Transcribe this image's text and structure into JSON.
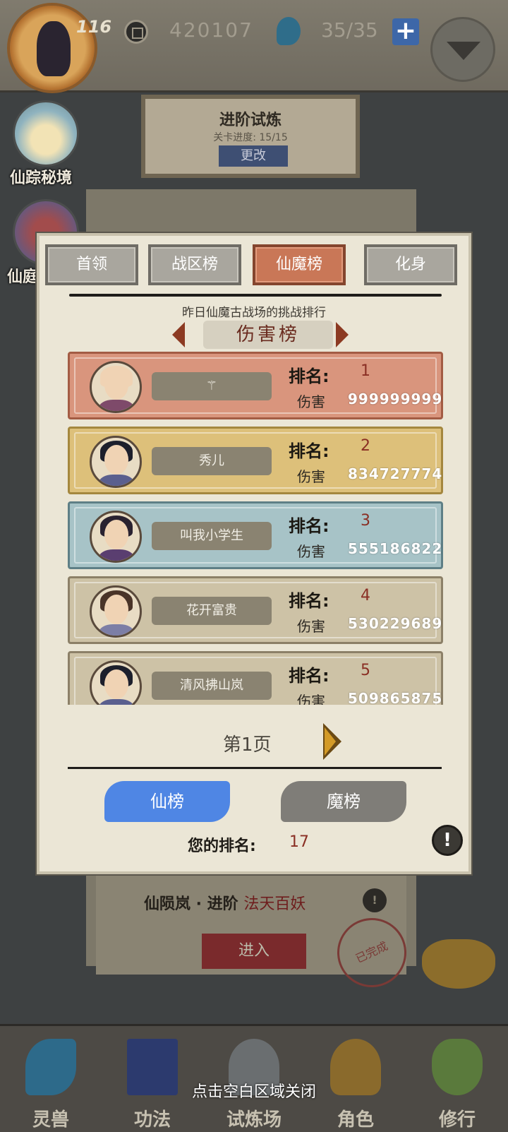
{
  "header": {
    "level": "116",
    "coins": "420107",
    "spirit": "35/35",
    "plus_label": "+"
  },
  "side_buttons": [
    {
      "label": "仙踪秘境"
    },
    {
      "label": "仙庭"
    }
  ],
  "trial_card": {
    "title": "进阶试炼",
    "progress": "关卡进度:  15/15",
    "change_label": "更改"
  },
  "background_stage": {
    "name": "仙陨岚 · 进阶",
    "boss": "法天百妖",
    "enter_label": "进入",
    "stamp": "已完成"
  },
  "modal": {
    "tabs": [
      {
        "label": "首领",
        "active": false
      },
      {
        "label": "战区榜",
        "active": false
      },
      {
        "label": "仙魔榜",
        "active": true
      },
      {
        "label": "化身",
        "active": false
      }
    ],
    "subtitle": "昨日仙魔古战场的挑战排行",
    "board_title": "伤害榜",
    "rank_label": "排名:",
    "damage_label": "伤害",
    "rows": [
      {
        "name": "⚚",
        "rank": "1",
        "damage": "999999999",
        "color": "#d9957d",
        "border": "#a35c44",
        "hair": "#f0d3b4",
        "body": "#7e4a6a"
      },
      {
        "name": "秀儿",
        "rank": "2",
        "damage": "834727774",
        "color": "#ddc07a",
        "border": "#a4873e",
        "hair": "#1d1f2c",
        "body": "#5a5f8e"
      },
      {
        "name": "叫我小学生",
        "rank": "3",
        "damage": "555186822",
        "color": "#a7c3c7",
        "border": "#5e7f86",
        "hair": "#2a2230",
        "body": "#5a3e70"
      },
      {
        "name": "花开富贵",
        "rank": "4",
        "damage": "530229689",
        "color": "#cdc2a6",
        "border": "#8c8068",
        "hair": "#4a3428",
        "body": "#7c7ea6"
      },
      {
        "name": "清风拂山岚",
        "rank": "5",
        "damage": "509865875",
        "color": "#cdc2a6",
        "border": "#8c8068",
        "hair": "#1d1f2c",
        "body": "#5a5f8e"
      }
    ],
    "page_label": "第1页",
    "xian_label": "仙榜",
    "mo_label": "魔榜",
    "my_rank_label": "您的排名:",
    "my_rank_value": "17",
    "info_label": "!"
  },
  "bottom_nav": [
    {
      "label": "灵兽",
      "icon": "spirit-beast-icon",
      "color": "#2d6a8a"
    },
    {
      "label": "功法",
      "icon": "book-icon",
      "color": "#2c3a6e"
    },
    {
      "label": "试炼场",
      "icon": "mountain-icon",
      "color": "#6a6e70"
    },
    {
      "label": "角色",
      "icon": "hat-icon",
      "color": "#8a6a2c"
    },
    {
      "label": "修行",
      "icon": "gourd-icon",
      "color": "#5a7a3c"
    }
  ],
  "close_hint": "点击空白区域关闭"
}
